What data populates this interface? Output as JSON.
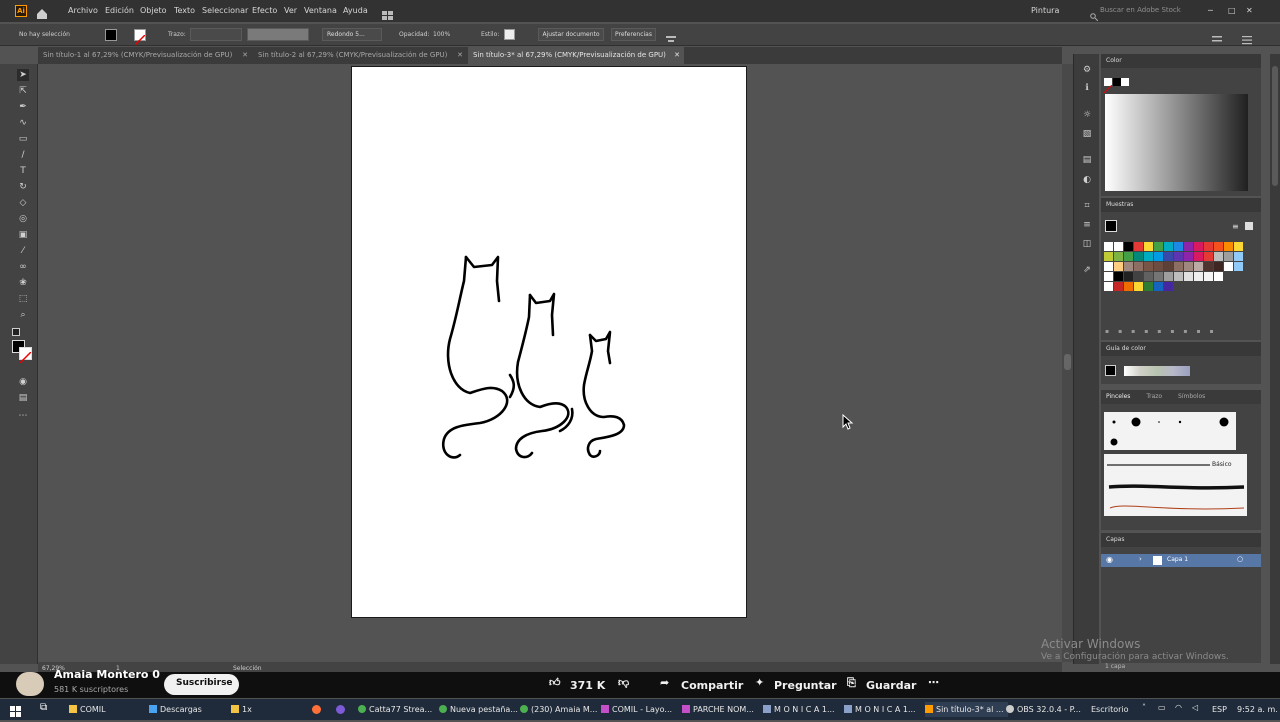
{
  "menubar": {
    "items": [
      "Archivo",
      "Edición",
      "Objeto",
      "Texto",
      "Seleccionar",
      "Efecto",
      "Ver",
      "Ventana",
      "Ayuda"
    ],
    "workspace": "Pintura",
    "search_placeholder": "Buscar en Adobe Stock",
    "logo": "Ai"
  },
  "control_bar": {
    "selection_label": "No hay selección",
    "stroke_label": "Trazo:",
    "brush_label": "Redondo 5...",
    "opacity_label": "Opacidad:",
    "opacity_value": "100%",
    "style_label": "Estilo:",
    "fit_button": "Ajustar documento",
    "prefs_button": "Preferencias"
  },
  "tabs": [
    {
      "label": "Sin título-1 al 67,29% (CMYK/Previsualización de GPU)"
    },
    {
      "label": "Sin título-2 al 67,29% (CMYK/Previsualización de GPU)"
    },
    {
      "label": "Sin título-3* al 67,29% (CMYK/Previsualización de GPU)"
    }
  ],
  "status": {
    "zoom": "67,29%",
    "artboard": "1",
    "tool": "Selección"
  },
  "panels": {
    "color_title": "Color",
    "swatches_title": "Muestras",
    "color_guide_title": "Guía de color",
    "brush_tabs": [
      "Pinceles",
      "Trazo",
      "Símbolos"
    ],
    "brush_basic": "Básico",
    "layers_title": "Capas",
    "layer_name": "Capa 1",
    "layers_count": "1 capa"
  },
  "watermark": {
    "title": "Activar Windows",
    "subtitle": "Ve a Configuración para activar Windows."
  },
  "youtube": {
    "channel": "Amaia Montero 0",
    "subscribers": "581 K suscriptores",
    "subscribe": "Suscribirse",
    "likes": "371 K",
    "share": "Compartir",
    "ask": "Preguntar",
    "save": "Guardar"
  },
  "taskbar": {
    "items": [
      "COMIL",
      "Descargas",
      "1x",
      "Catta77 Strea...",
      "Nueva pestaña...",
      "(230) Amaia M...",
      "COMIL - Layo...",
      "PARCHE NOM...",
      "M O N I C A  1...",
      "M O N I C A  1...",
      "Sin título-3* al ...",
      "OBS 32.0.4 - P..."
    ],
    "desktop": "Escritorio",
    "lang": "ESP",
    "time": "9:52 a. m."
  },
  "colors": {
    "app_bg": "#535353",
    "panel": "#434343",
    "header": "#323232",
    "active_layer": "#5777a6"
  }
}
